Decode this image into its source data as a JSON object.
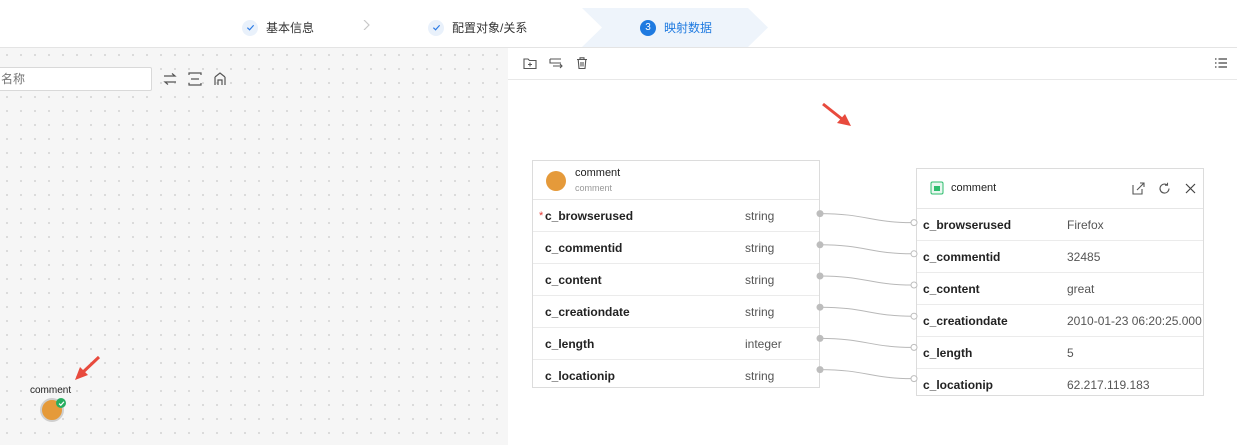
{
  "steps": [
    {
      "label": "基本信息",
      "state": "done"
    },
    {
      "label": "配置对象/关系",
      "state": "done"
    },
    {
      "label": "映射数据",
      "number": "3",
      "state": "active"
    }
  ],
  "canvas": {
    "search_placeholder": "名称",
    "node": {
      "label": "comment",
      "color": "#e59a3a"
    }
  },
  "source_card": {
    "title": "comment",
    "subtitle": "comment",
    "icon_color": "#e59a3a",
    "fields": [
      {
        "name": "c_browserused",
        "type": "string",
        "required": "*"
      },
      {
        "name": "c_commentid",
        "type": "string",
        "required": ""
      },
      {
        "name": "c_content",
        "type": "string",
        "required": ""
      },
      {
        "name": "c_creationdate",
        "type": "string",
        "required": ""
      },
      {
        "name": "c_length",
        "type": "integer",
        "required": ""
      },
      {
        "name": "c_locationip",
        "type": "string",
        "required": ""
      }
    ]
  },
  "target_card": {
    "title": "comment",
    "fields": [
      {
        "name": "c_browserused",
        "value": "Firefox"
      },
      {
        "name": "c_commentid",
        "value": "32485"
      },
      {
        "name": "c_content",
        "value": "great"
      },
      {
        "name": "c_creationdate",
        "value": "2010-01-23 06:20:25.000"
      },
      {
        "name": "c_length",
        "value": "5"
      },
      {
        "name": "c_locationip",
        "value": "62.217.119.183"
      }
    ]
  },
  "colors": {
    "accent": "#1f7ae0",
    "required": "#e53935",
    "annotation_arrow": "#e84a3d",
    "check": "#27ae60"
  }
}
